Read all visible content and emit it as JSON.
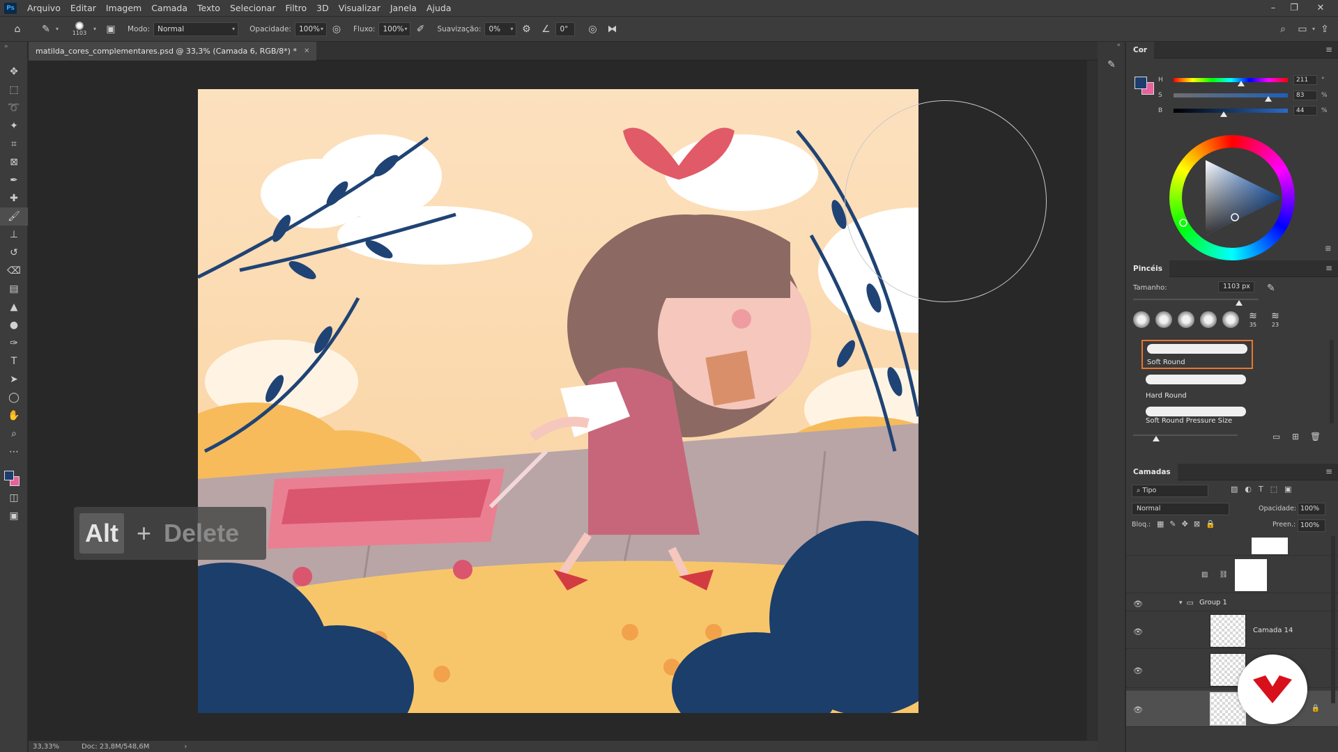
{
  "app": {
    "logo": "Ps"
  },
  "menu": [
    "Arquivo",
    "Editar",
    "Imagem",
    "Camada",
    "Texto",
    "Selecionar",
    "Filtro",
    "3D",
    "Visualizar",
    "Janela",
    "Ajuda"
  ],
  "window_controls": {
    "minimize": "–",
    "restore": "❐",
    "close": "✕"
  },
  "options": {
    "brush_size": "1103",
    "mode_label": "Modo:",
    "mode_value": "Normal",
    "opacity_label": "Opacidade:",
    "opacity_value": "100%",
    "flow_label": "Fluxo:",
    "flow_value": "100%",
    "smoothing_label": "Suavização:",
    "smoothing_value": "0%",
    "angle_value": "0°"
  },
  "document": {
    "tab_title": "matilda_cores_complementares.psd @ 33,3% (Camada 6, RGB/8*) *",
    "zoom": "33,33%",
    "doc_info": "Doc: 23,8M/548,6M"
  },
  "key_overlay": {
    "key1": "Alt",
    "plus": "+",
    "key2": "Delete"
  },
  "color_panel": {
    "title": "Cor",
    "foreground": "#1c3d6e",
    "background": "#e8609c",
    "h_label": "H",
    "h_value": "211",
    "h_unit": "°",
    "h_level": 0.59,
    "s_label": "S",
    "s_value": "83",
    "s_unit": "%",
    "s_level": 0.83,
    "b_label": "B",
    "b_value": "44",
    "b_unit": "%",
    "b_level": 0.44
  },
  "brushes_panel": {
    "title": "Pincéis",
    "size_label": "Tamanho:",
    "size_value": "1103 px",
    "preset_nums": [
      "35",
      "23"
    ],
    "items": [
      {
        "name": "Soft Round"
      },
      {
        "name": "Hard Round"
      },
      {
        "name": "Soft Round Pressure Size"
      }
    ]
  },
  "layers_panel": {
    "title": "Camadas",
    "filter_value": "Tipo",
    "blend_mode": "Normal",
    "opacity_label": "Opacidade:",
    "opacity_value": "100%",
    "lock_label": "Bloq.:",
    "fill_label": "Preen.:",
    "fill_value": "100%",
    "group_name": "Group 1",
    "layers": [
      {
        "name": "Camada 14"
      },
      {
        "name": ""
      },
      {
        "name": ""
      }
    ]
  }
}
